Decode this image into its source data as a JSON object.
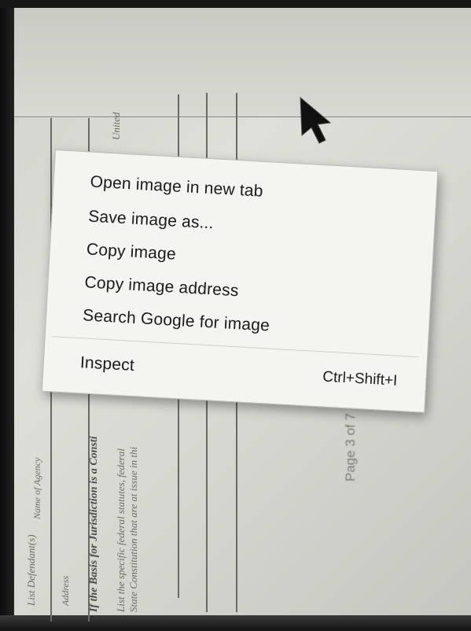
{
  "context_menu": {
    "items": [
      {
        "label": "Open image in new tab"
      },
      {
        "label": "Save image as..."
      },
      {
        "label": "Copy image"
      },
      {
        "label": "Copy image address"
      },
      {
        "label": "Search Google for image"
      }
    ],
    "inspect": {
      "label": "Inspect",
      "shortcut": "Ctrl+Shift+I"
    }
  },
  "document": {
    "word_top": "United",
    "label_agency": "Name of Agency",
    "label_address": "Address",
    "label_defendant": "List Defendant(s)",
    "heading_basis": "If the Basis for Jurisdiction is a Consti",
    "line_list": "List the specific federal statutes, federal",
    "line_state": "State Constitution that are at issue in thi",
    "page_label": "Page 3 of 7"
  },
  "colors": {
    "menu_bg": "#f4f5f1",
    "screen_bg": "#d6d7d0"
  }
}
